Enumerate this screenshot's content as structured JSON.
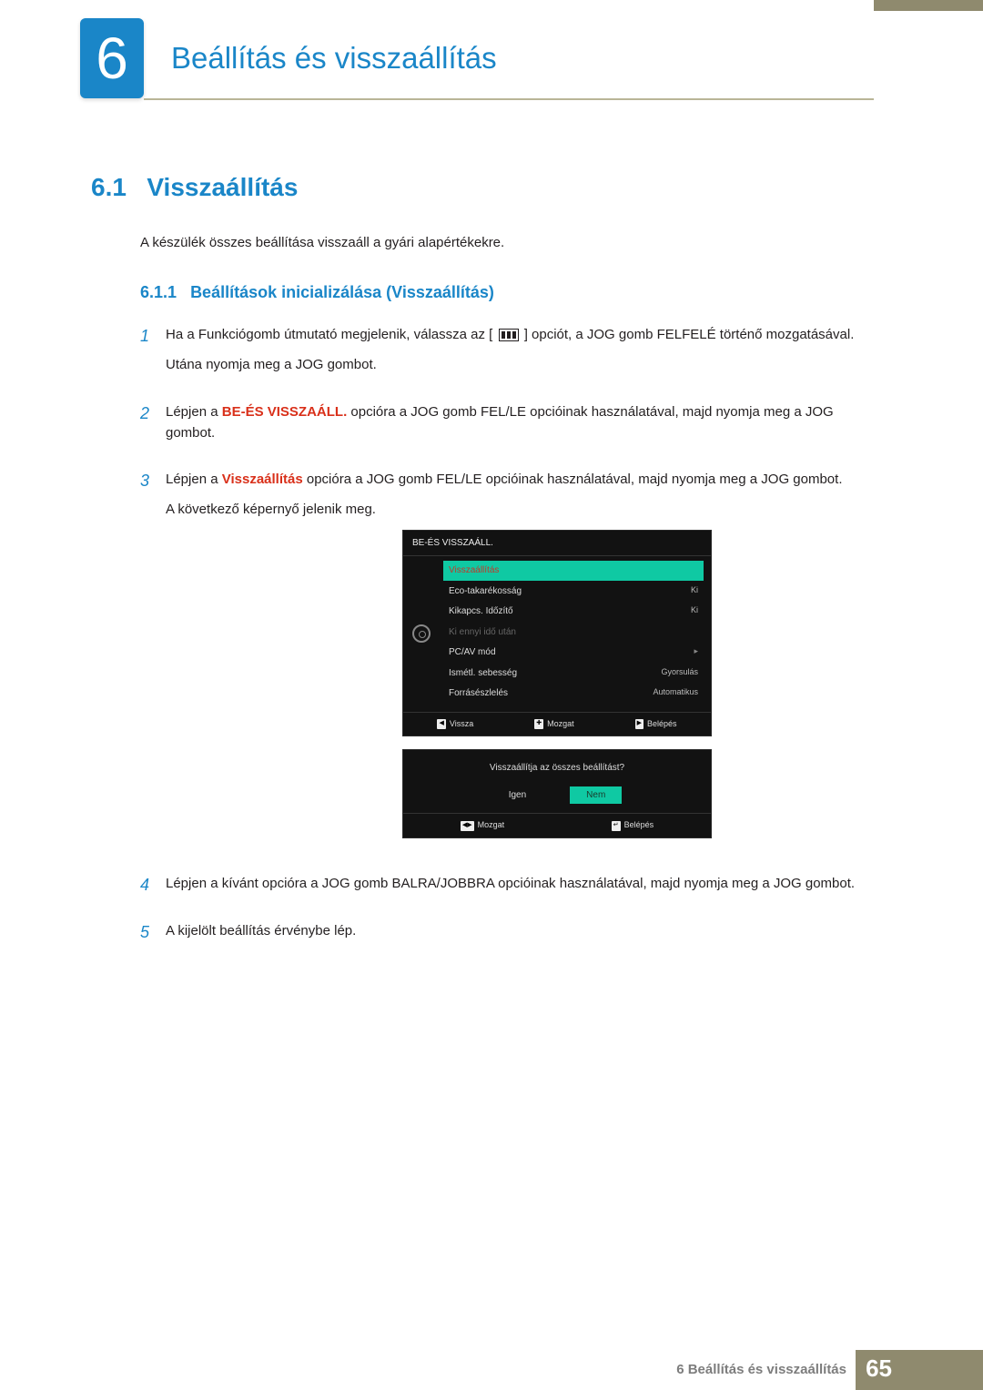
{
  "chapter": {
    "number": "6",
    "title": "Beállítás és visszaállítás"
  },
  "section": {
    "number": "6.1",
    "title": "Visszaállítás",
    "intro": "A készülék összes beállítása visszaáll a gyári alapértékekre."
  },
  "subsection": {
    "number": "6.1.1",
    "title": "Beállítások inicializálása (Visszaállítás)"
  },
  "steps": {
    "s1": {
      "num": "1",
      "p1a": "Ha a Funkciógomb útmutató megjelenik, válassza az [",
      "p1b": "] opciót, a JOG gomb FELFELÉ történő mozgatásával.",
      "p2": "Utána nyomja meg a JOG gombot."
    },
    "s2": {
      "num": "2",
      "p1a": "Lépjen a ",
      "hl": "BE-ÉS VISSZAÁLL.",
      "p1b": " opcióra a JOG gomb FEL/LE opcióinak használatával, majd nyomja meg a JOG gombot."
    },
    "s3": {
      "num": "3",
      "p1a": "Lépjen a ",
      "hl": "Visszaállítás",
      "p1b": " opcióra a JOG gomb FEL/LE opcióinak használatával, majd nyomja meg a JOG gombot.",
      "p2": "A következő képernyő jelenik meg."
    },
    "s4": {
      "num": "4",
      "text": "Lépjen a kívánt opcióra a JOG gomb BALRA/JOBBRA opcióinak használatával, majd nyomja meg a JOG gombot."
    },
    "s5": {
      "num": "5",
      "text": "A kijelölt beállítás érvénybe lép."
    }
  },
  "osd": {
    "header": "BE-ÉS VISSZAÁLL.",
    "items": [
      {
        "label": "Visszaállítás",
        "value": "",
        "active": true
      },
      {
        "label": "Eco-takarékosság",
        "value": "Ki"
      },
      {
        "label": "Kikapcs. Időzítő",
        "value": "Ki"
      },
      {
        "label": "Ki ennyi idő után",
        "value": "",
        "dim": true
      },
      {
        "label": "PC/AV mód",
        "value": "",
        "arrow": true
      },
      {
        "label": "Ismétl. sebesség",
        "value": "Gyorsulás"
      },
      {
        "label": "Forrásészlelés",
        "value": "Automatikus"
      }
    ],
    "footer": {
      "back": "Vissza",
      "move": "Mozgat",
      "enter": "Belépés"
    }
  },
  "confirm": {
    "question": "Visszaállítja az összes beállítást?",
    "yes": "Igen",
    "no": "Nem",
    "move": "Mozgat",
    "enter": "Belépés"
  },
  "footer": {
    "title": "6 Beállítás és visszaállítás",
    "page": "65"
  }
}
